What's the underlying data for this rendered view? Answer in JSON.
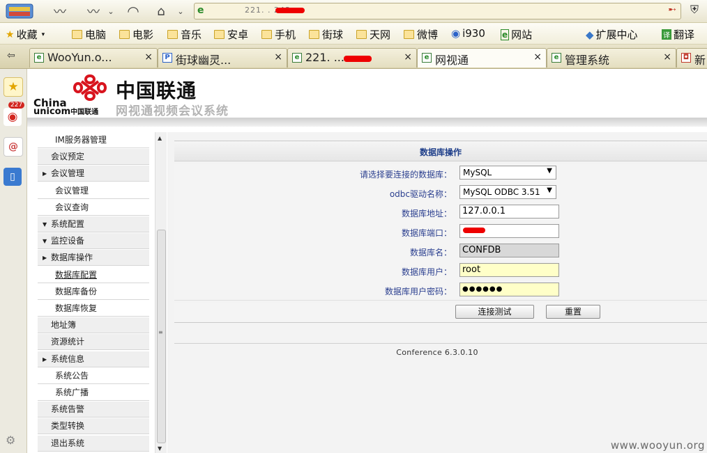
{
  "browser": {
    "address_url": "221.  .  243",
    "bookmarks": [
      {
        "label": "收藏",
        "icon": "star-icon",
        "dropdown": true
      },
      {
        "label": "电脑",
        "icon": "folder-icon"
      },
      {
        "label": "电影",
        "icon": "folder-icon"
      },
      {
        "label": "音乐",
        "icon": "folder-icon"
      },
      {
        "label": "安卓",
        "icon": "folder-icon"
      },
      {
        "label": "手机",
        "icon": "folder-icon"
      },
      {
        "label": "街球",
        "icon": "folder-icon"
      },
      {
        "label": "天网",
        "icon": "folder-icon"
      },
      {
        "label": "微博",
        "icon": "folder-icon"
      },
      {
        "label": "i930",
        "icon": "play-icon"
      },
      {
        "label": "网站",
        "icon": "page-icon"
      },
      {
        "label": "扩展中心",
        "icon": "cube-icon"
      },
      {
        "label": "翻译",
        "icon": "translate-icon"
      }
    ],
    "tabs": [
      {
        "title": "WooYun.o...",
        "close": "×"
      },
      {
        "title": "街球幽灵...",
        "close": "×"
      },
      {
        "title": "221.     ...",
        "close": "×"
      },
      {
        "title": "网视通",
        "close": "×",
        "active": true
      },
      {
        "title": "管理系统",
        "close": "×"
      },
      {
        "title": "新",
        "close": ""
      }
    ],
    "sidebar_badge": "227"
  },
  "header": {
    "brand_en_line1": "China",
    "brand_en_line2": "unicom",
    "brand_en_line2_cn": "中国联通",
    "brand_cn": "中国联通",
    "system_name": "网视通视频会议系统"
  },
  "nav": {
    "items": [
      {
        "label": "IM服务器管理",
        "type": "child"
      },
      {
        "label": "会议预定",
        "type": "plain"
      },
      {
        "label": "会议管理",
        "type": "parent",
        "arrow": "▶"
      },
      {
        "label": "会议管理",
        "type": "child"
      },
      {
        "label": "会议查询",
        "type": "child"
      },
      {
        "label": "系统配置",
        "type": "parent",
        "arrow": "▼"
      },
      {
        "label": "监控设备",
        "type": "parent",
        "arrow": "▼"
      },
      {
        "label": "数据库操作",
        "type": "parent",
        "arrow": "▶"
      },
      {
        "label": "数据库配置",
        "type": "child",
        "underline": true
      },
      {
        "label": "数据库备份",
        "type": "child"
      },
      {
        "label": "数据库恢复",
        "type": "child"
      },
      {
        "label": "地址簿",
        "type": "plain"
      },
      {
        "label": "资源统计",
        "type": "plain"
      },
      {
        "label": "系统信息",
        "type": "parent",
        "arrow": "▶"
      },
      {
        "label": "系统公告",
        "type": "child"
      },
      {
        "label": "系统广播",
        "type": "child"
      },
      {
        "label": "系统告警",
        "type": "plain"
      },
      {
        "label": "类型转换",
        "type": "plain"
      },
      {
        "label": "退出系统",
        "type": "plain"
      }
    ]
  },
  "form": {
    "title": "数据库操作",
    "db_type": {
      "label": "请选择要连接的数据库：",
      "value": "MySQL"
    },
    "odbc_driver": {
      "label": "odbc驱动名称：",
      "value": "MySQL ODBC 3.51"
    },
    "db_address": {
      "label": "数据库地址：",
      "value": "127.0.0.1"
    },
    "db_port": {
      "label": "数据库端口：",
      "value": ""
    },
    "db_name": {
      "label": "数据库名：",
      "value": "CONFDB"
    },
    "db_user": {
      "label": "数据库用户：",
      "value": "root"
    },
    "db_password": {
      "label": "数据库用户密码：",
      "value": "●●●●●●"
    },
    "test_button": "连接测试",
    "reset_button": "重置"
  },
  "footer": "Conference 6.3.0.10",
  "watermark": "www.wooyun.org",
  "colors": {
    "label_blue": "#2b3f8f",
    "unicom_red": "#d8141e",
    "readonly_gray": "#d8d8d8",
    "password_yellow": "#ffffc8"
  }
}
